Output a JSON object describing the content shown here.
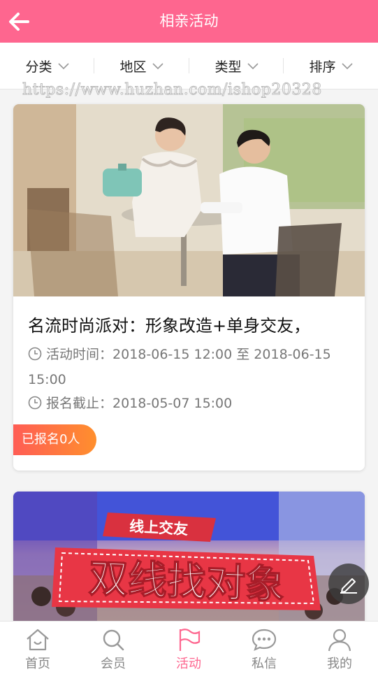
{
  "header": {
    "title": "相亲活动",
    "back_icon": "arrow-left-icon"
  },
  "filters": [
    {
      "label": "分类"
    },
    {
      "label": "地区"
    },
    {
      "label": "类型"
    },
    {
      "label": "排序"
    }
  ],
  "watermark": "https://www.huzhan.com/ishop20328",
  "activities": [
    {
      "title": "名流时尚派对：形象改造+单身交友，",
      "time_label": "活动时间：",
      "time_value": "2018-06-15 12:00 至 2018-06-15 15:00",
      "deadline_label": "报名截止：",
      "deadline_value": "2018-05-07 15:00",
      "registered": "已报名0人"
    },
    {
      "banner_small": "线上交友",
      "banner_big": "双线找对象"
    }
  ],
  "tabs": [
    {
      "label": "首页",
      "icon": "home-icon"
    },
    {
      "label": "会员",
      "icon": "search-icon"
    },
    {
      "label": "活动",
      "icon": "flag-icon"
    },
    {
      "label": "私信",
      "icon": "chat-icon"
    },
    {
      "label": "我的",
      "icon": "user-icon"
    }
  ],
  "colors": {
    "accent": "#fe668f",
    "badge_start": "#ff5d55",
    "badge_end": "#ff8f2d"
  }
}
